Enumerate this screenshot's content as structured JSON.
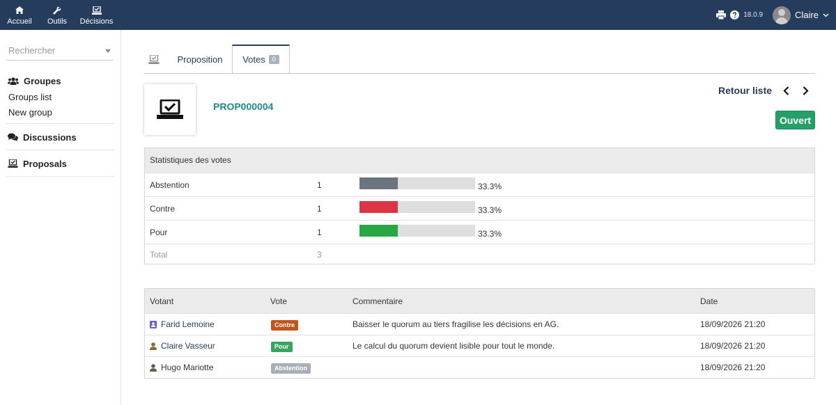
{
  "topnav": [
    {
      "label": "Accueil",
      "icon": "home-icon"
    },
    {
      "label": "Outils",
      "icon": "wrench-icon"
    },
    {
      "label": "Décisions",
      "icon": "ballot-icon"
    }
  ],
  "header": {
    "version": "18.0.9",
    "user": "Claire"
  },
  "sidebar": {
    "search_placeholder": "Rechercher",
    "groups_title": "Groupes",
    "groups_links": [
      "Groups list",
      "New group"
    ],
    "discussions_title": "Discussions",
    "proposals_title": "Proposals"
  },
  "tabs": {
    "proposition": "Proposition",
    "votes": "Votes",
    "votes_count": "0"
  },
  "record": {
    "ref": "PROP000004",
    "back_label": "Retour liste",
    "status": "Ouvert"
  },
  "stats": {
    "title": "Statistiques des votes",
    "rows": [
      {
        "label": "Abstention",
        "count": "1",
        "percent": "33.3%",
        "fraction": 0.333,
        "color": "#6c757d"
      },
      {
        "label": "Contre",
        "count": "1",
        "percent": "33.3%",
        "fraction": 0.333,
        "color": "#dc3545"
      },
      {
        "label": "Pour",
        "count": "1",
        "percent": "33.3%",
        "fraction": 0.333,
        "color": "#28a745"
      }
    ],
    "total_label": "Total",
    "total_count": "3"
  },
  "votes_table": {
    "headers": [
      "Votant",
      "Vote",
      "Commentaire",
      "Date"
    ],
    "rows": [
      {
        "voter": "Farid Lemoine",
        "vote": "Contre",
        "vote_color": "#c0561b",
        "comment": "Baisser le quorum au tiers fragilise les décisions en AG.",
        "date": "18/09/2026 21:20"
      },
      {
        "voter": "Claire Vasseur",
        "vote": "Pour",
        "vote_color": "#3aa35f",
        "comment": "Le calcul du quorum devient lisible pour tout le monde.",
        "date": "18/09/2026 21:20"
      },
      {
        "voter": "Hugo Mariotte",
        "vote": "Abstention",
        "vote_color": "#a8aeb8",
        "comment": "",
        "date": "18/09/2026 21:20"
      }
    ]
  }
}
